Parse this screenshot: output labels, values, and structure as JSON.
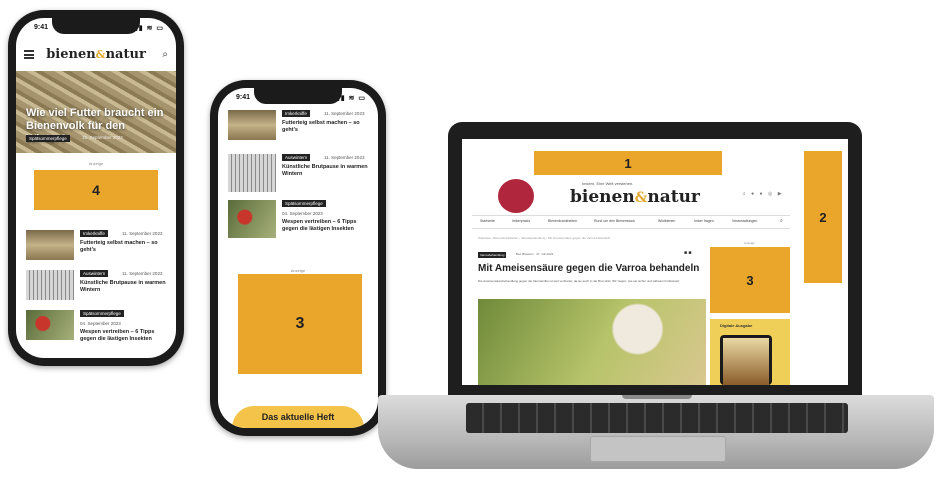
{
  "phone_left": {
    "status_time": "9:41",
    "logo_text": "bienen",
    "logo_amp": "&",
    "logo_text2": "natur",
    "hero": {
      "title": "Wie viel Futter braucht ein Bienenvolk für den Winter?",
      "category": "Spätsommerpflege",
      "date": "15. September 2023"
    },
    "ad_label": "Anzeige",
    "ad_number": "4",
    "articles": [
      {
        "category": "Imkerkniffe",
        "date": "11. September 2023",
        "title": "Futterteig selbst machen – so geht’s",
        "thumb": "frame"
      },
      {
        "category": "Auswintern",
        "date": "11. September 2023",
        "title": "Künstliche Brutpause in warmen Wintern",
        "thumb": "grid"
      },
      {
        "category": "Spätsommerpflege",
        "date": "04. September 2023",
        "title": "Wespen vertreiben – 6 Tipps gegen die lästigen Insekten",
        "thumb": "bird"
      }
    ]
  },
  "phone_middle": {
    "status_time": "9:41",
    "articles": [
      {
        "category": "Imkerkniffe",
        "date": "11. September 2023",
        "title": "Futterteig selbst machen – so geht’s"
      },
      {
        "category": "Auswintern",
        "date": "11. September 2023",
        "title": "Künstliche Brutpause in warmen Wintern"
      },
      {
        "category": "Spätsommerpflege",
        "date": "04. September 2023",
        "title": "Wespen vertreiben – 6 Tipps gegen die lästigen Insekten"
      }
    ],
    "ad_label": "Anzeige",
    "ad_number": "3",
    "heft_label": "Das aktuelle Heft"
  },
  "laptop": {
    "ad_top_number": "1",
    "ad_right_number": "2",
    "ad_side_number": "3",
    "tagline": "Imkern. Eine Welt verstehen.",
    "logo_text": "bienen",
    "logo_amp": "&",
    "logo_text2": "natur",
    "badge_text": "Probeabo",
    "social_icons": "♫ ● ● ◎ ▶",
    "nav": [
      "Startseite",
      "Imkerpraxis",
      "Bienenkrankheiten",
      "Rund um den Bienenstock",
      "Wildbienen",
      "Imker fragen",
      "Veranstaltungen"
    ],
    "breadcrumb": "Startseite › Bienenkrankheiten › Varroabehandlung › Mit Ameisensäure gegen die Varroa behandeln",
    "article": {
      "category": "Varroabehandlung",
      "author": "Bee Blossom",
      "date": "27. Juli 2023",
      "title": "Mit Ameisensäure gegen die Varroa behandeln",
      "intro": "Die Ameisensäurebehandlung gegen die Varroamilbe ist weit verbreitet, da sie auch in die Brut wirkt. Wir zeigen, wie sie sicher und wirksam funktioniert."
    },
    "aside_label": "Anzeige",
    "digital_label": "Digitale Ausgabe"
  }
}
